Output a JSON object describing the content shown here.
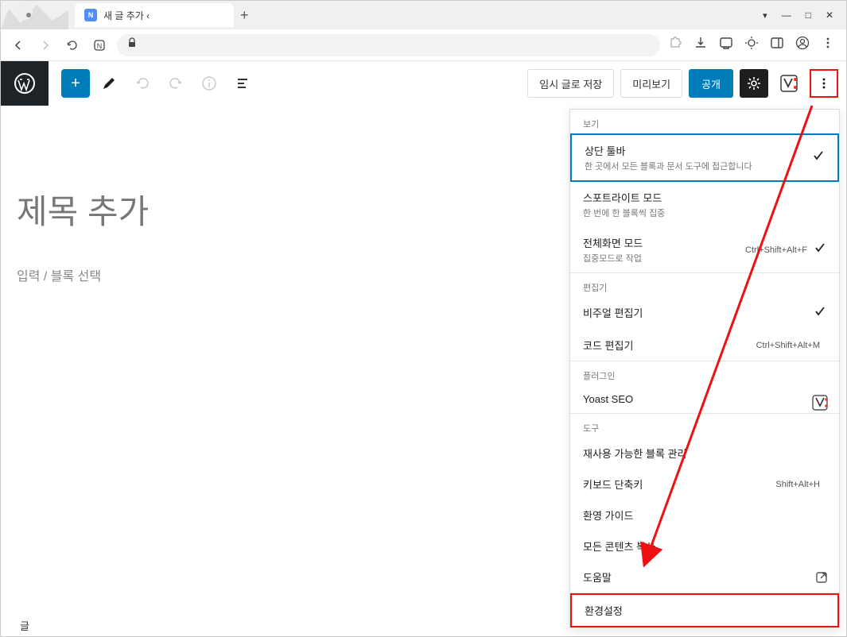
{
  "window": {
    "tab_title": "새 글 추가 ‹"
  },
  "editor": {
    "save_draft": "임시 글로 저장",
    "preview": "미리보기",
    "publish": "공개",
    "title_placeholder": "제목 추가",
    "block_placeholder": "입력 / 블록 선택"
  },
  "breadcrumb": "글",
  "menu": {
    "section_view": "보기",
    "top_toolbar": {
      "label": "상단 툴바",
      "desc": "한 곳에서 모든 블록과 문서 도구에 접근합니다"
    },
    "spotlight": {
      "label": "스포트라이트 모드",
      "desc": "한 번에 한 블록씩 집중"
    },
    "fullscreen": {
      "label": "전체화면 모드",
      "desc": "집중모드로 작업",
      "shortcut": "Ctrl+Shift+Alt+F"
    },
    "section_editor": "편집기",
    "visual_editor": "비주얼 편집기",
    "code_editor": {
      "label": "코드 편집기",
      "shortcut": "Ctrl+Shift+Alt+M"
    },
    "section_plugins": "플러그인",
    "yoast": "Yoast SEO",
    "section_tools": "도구",
    "reusable_blocks": "재사용 가능한 블록 관리",
    "keyboard_shortcut": {
      "label": "키보드 단축키",
      "shortcut": "Shift+Alt+H"
    },
    "welcome_guide": "환영 가이드",
    "copy_all": "모든 콘텐츠 복사",
    "help": "도움말",
    "preferences": "환경설정"
  }
}
